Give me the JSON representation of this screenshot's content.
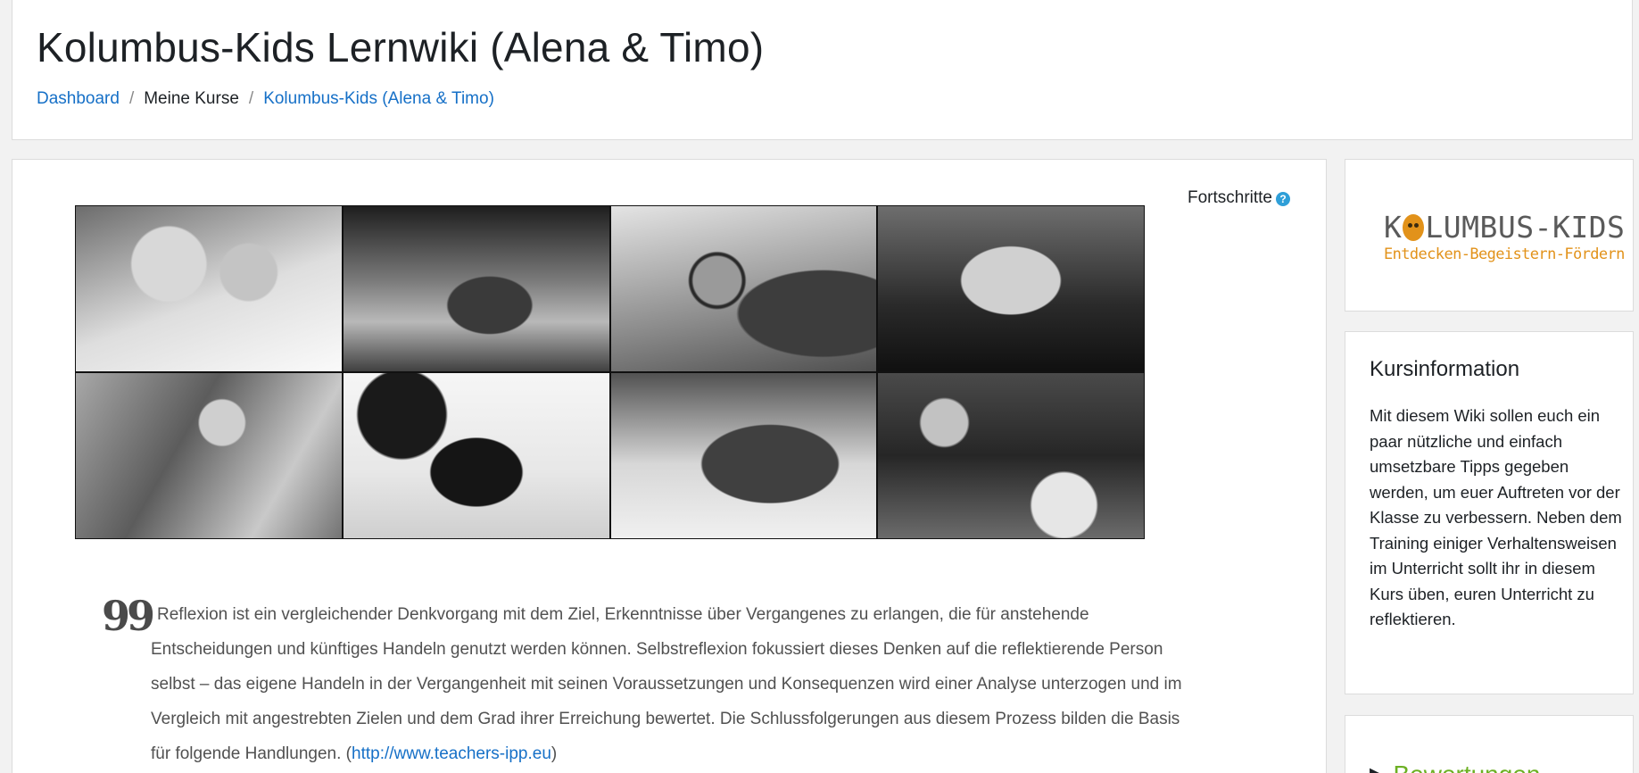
{
  "header": {
    "title": "Kolumbus-Kids Lernwiki (Alena & Timo)",
    "breadcrumb": [
      {
        "label": "Dashboard",
        "link": true
      },
      {
        "label": "Meine Kurse",
        "link": false
      },
      {
        "label": "Kolumbus-Kids (Alena & Timo)",
        "link": true
      }
    ],
    "separator": "/"
  },
  "main": {
    "progress_label": "Fortschritte",
    "help_icon": "question-circle-icon",
    "banner_photos": 8,
    "quote": {
      "icon": "quote-icon",
      "icon_glyph": "99",
      "lines": [
        "Reflexion ist ein vergleichender Denkvorgang mit dem Ziel, Erkenntnisse über Vergangenes zu erlangen, die für anstehende",
        "Entscheidungen und künftiges Handeln genutzt werden können. Selbstreflexion fokussiert dieses Denken auf die reflektierende Person",
        "selbst – das eigene Handeln in der Vergangenheit mit seinen Voraussetzungen und Konsequenzen wird einer Analyse unterzogen und im",
        "Vergleich mit angestrebten Zielen und dem Grad ihrer Erreichung bewertet. Die Schlussfolgerungen aus diesem Prozess bilden die Basis"
      ],
      "last_line_prefix": "für folgende Handlungen. (",
      "link_text": "http://www.teachers-ipp.eu",
      "last_line_suffix": ")"
    }
  },
  "sidebar": {
    "logo": {
      "part1": "K",
      "part2": "LUMBUS-KIDS",
      "tagline": "Entdecken-Begeistern-Fördern",
      "brand_color": "#e2921a"
    },
    "course_info": {
      "title": "Kursinformation",
      "text": "Mit diesem Wiki sollen euch ein paar nützliche und einfach umsetzbare Tipps gegeben werden, um euer Auftreten vor der Klasse zu verbessern. Neben dem Training einiger Verhaltensweisen im Unterricht sollt ihr in diesem Kurs üben, euren Unterricht zu reflektieren."
    },
    "ratings": {
      "icon": "triangle-right-icon",
      "label": "Bewertungen",
      "color": "#6cb023"
    }
  },
  "colors": {
    "link": "#1670c7",
    "background": "#f2f2f2",
    "help_icon": "#2f9fd8"
  }
}
